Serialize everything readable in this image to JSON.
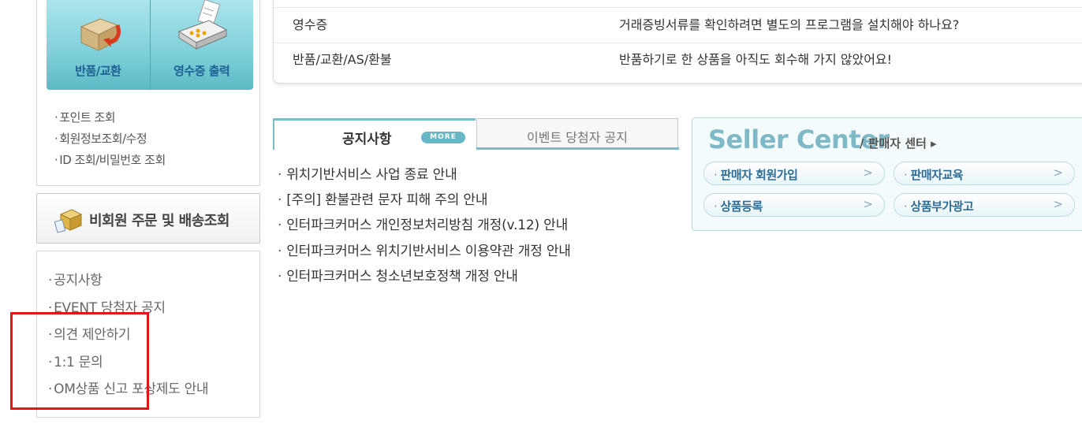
{
  "left_tiles": [
    {
      "label": "반품/교환",
      "icon": "box-return-icon"
    },
    {
      "label": "영수증 출력",
      "icon": "receipt-printer-icon"
    }
  ],
  "quick_links": [
    "포인트 조회",
    "회원정보조회/수정",
    "ID 조회/비밀번호 조회"
  ],
  "guest": {
    "label": "비회원 주문 및 배송조회",
    "icon": "package-icon"
  },
  "support_links": [
    "공지사항",
    "EVENT 당첨자 공지",
    "의견 제안하기",
    "1:1 문의",
    "OM상품 신고 포상제도 안내"
  ],
  "faq": [
    {
      "category": "영수증",
      "question": "거래증빙서류를 확인하려면 별도의 프로그램을 설치해야 하나요?"
    },
    {
      "category": "반품/교환/AS/환불",
      "question": "반품하기로 한 상품을 아직도 회수해 가지 않았어요!"
    }
  ],
  "tabs": {
    "notice_label": "공지사항",
    "more_label": "MORE",
    "event_label": "이벤트 당첨자 공지"
  },
  "notices": [
    "위치기반서비스 사업 종료 안내",
    "[주의] 환불관련 문자 피해 주의 안내",
    "인터파크커머스 개인정보처리방침 개정(v.12) 안내",
    "인터파크커머스 위치기반서비스 이용약관 개정 안내",
    "인터파크커머스 청소년보호정책 개정 안내"
  ],
  "seller": {
    "title": "Seller Center",
    "subtitle": "/ 판매자 센터 ▸",
    "buttons": [
      "판매자 회원가입",
      "판매자교육",
      "상품등록",
      "상품부가광고"
    ]
  },
  "colors": {
    "accent": "#7bbcc8",
    "highlight": "#e0161c",
    "tile": "#7fd0da"
  }
}
